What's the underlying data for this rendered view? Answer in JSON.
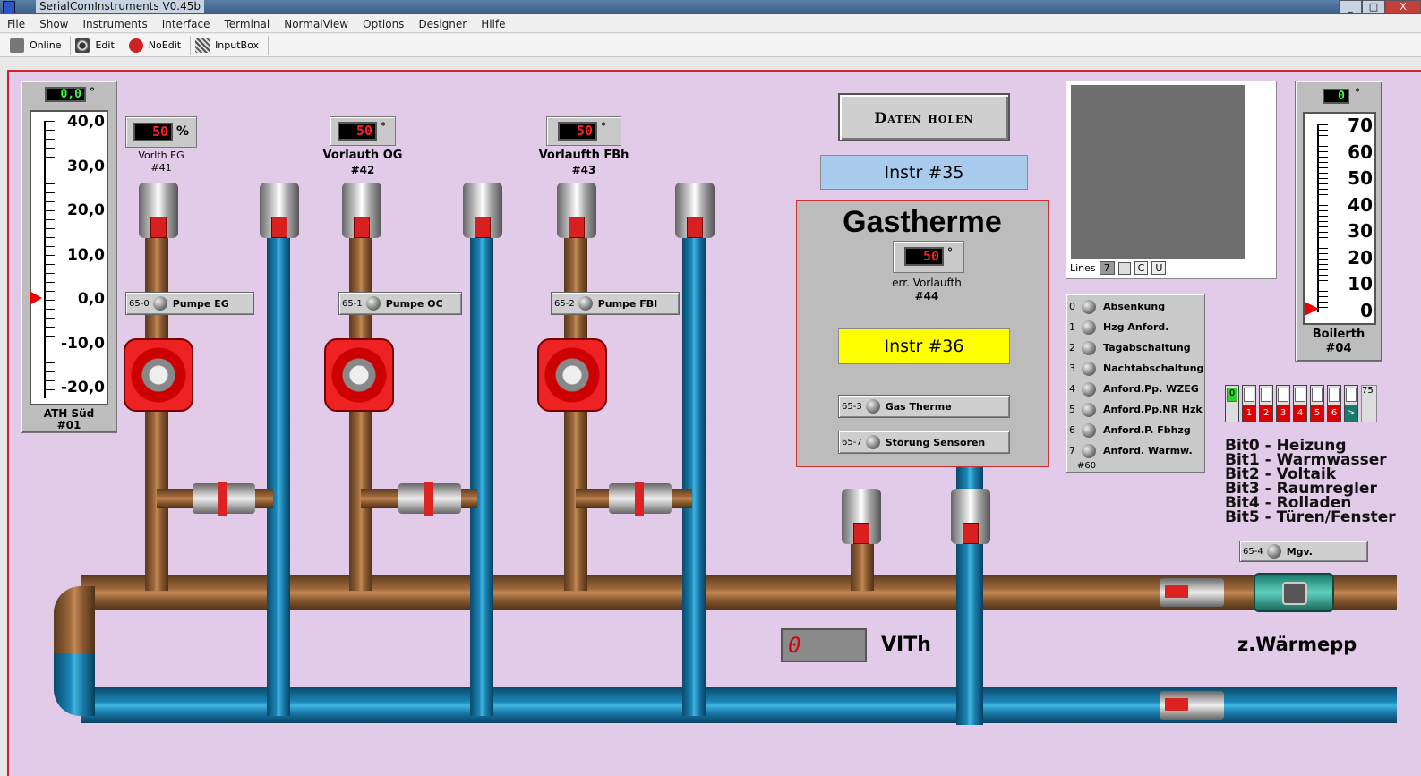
{
  "window": {
    "title": "SerialComInstruments  V0.45b",
    "min": "_",
    "max": "□",
    "close": "X"
  },
  "menu": [
    "File",
    "Show",
    "Instruments",
    "Interface",
    "Terminal",
    "NormalView",
    "Options",
    "Designer",
    "Hilfe"
  ],
  "toolbar": {
    "online": "Online",
    "edit": "Edit",
    "noedit": "NoEdit",
    "inputbox": "InputBox"
  },
  "ath": {
    "value": "0,0",
    "unit": "°",
    "label": "ATH Süd",
    "id": "#01",
    "scale": [
      "40,0",
      "30,0",
      "20,0",
      "10,0",
      "0,0",
      "-10,0",
      "-20,0"
    ],
    "marker_value": 0.0
  },
  "boiler": {
    "value": "0",
    "unit": "°",
    "label": "Boilerth",
    "id": "#04",
    "scale": [
      "70",
      "60",
      "50",
      "40",
      "30",
      "20",
      "10",
      "0"
    ],
    "marker_value": 0
  },
  "g41": {
    "value": "50",
    "unit": "%",
    "label": "Vorlth EG",
    "id": "#41"
  },
  "g42": {
    "value": "50",
    "unit": "°",
    "label": "Vorlauth OG",
    "id": "#42"
  },
  "g43": {
    "value": "50",
    "unit": "°",
    "label": "Vorlaufth FBh",
    "id": "#43"
  },
  "b650": {
    "no": "65-0",
    "label": "Pumpe EG"
  },
  "b651": {
    "no": "65-1",
    "label": "Pumpe OC"
  },
  "b652": {
    "no": "65-2",
    "label": "Pumpe FBI"
  },
  "daten": "Daten holen",
  "instr35": "Instr #35",
  "gas": {
    "title": "Gastherme",
    "value": "50",
    "unit": "°",
    "label": "err. Vorlaufth",
    "id": "#44",
    "instr36": "Instr #36"
  },
  "b653": {
    "no": "65-3",
    "label": "Gas Therme"
  },
  "b657": {
    "no": "65-7",
    "label": "Störung Sensoren"
  },
  "b654": {
    "no": "65-4",
    "label": "Mgv."
  },
  "terminal": {
    "lines_label": "Lines",
    "lines_value": "7",
    "c": "C",
    "u": "U"
  },
  "status": {
    "id": "#60",
    "items": [
      {
        "n": "0",
        "t": "Absenkung"
      },
      {
        "n": "1",
        "t": "Hzg Anford."
      },
      {
        "n": "2",
        "t": "Tagabschaltung"
      },
      {
        "n": "3",
        "t": "Nachtabschaltung"
      },
      {
        "n": "4",
        "t": "Anford.Pp. WZEG"
      },
      {
        "n": "5",
        "t": "Anford.Pp.NR Hzk"
      },
      {
        "n": "6",
        "t": "Anford.P. Fbhzg"
      },
      {
        "n": "7",
        "t": "Anford. Warmw."
      }
    ]
  },
  "bits": {
    "first": "0",
    "labels": [
      "1",
      "2",
      "3",
      "4",
      "5",
      "6",
      ">"
    ],
    "value": "75"
  },
  "bitlegend": [
    "Bit0 - Heizung",
    "Bit1 - Warmwasser",
    "Bit2 - Voltaik",
    "Bit3 - Raumregler",
    "Bit4 - Rolladen",
    "Bit5 - Türen/Fenster"
  ],
  "vith": {
    "value": "0",
    "label": "VITh"
  },
  "waermepp": "z.Wärmepp",
  "colors": {
    "canvas": "#e1cbe8",
    "lcd_green": "#39ff3a",
    "lcd_red": "#ff2020",
    "instr35": "#a9cbee",
    "instr36": "#ffff00",
    "hot_pipe": "#a06a3c",
    "cold_pipe": "#1a86b8"
  }
}
